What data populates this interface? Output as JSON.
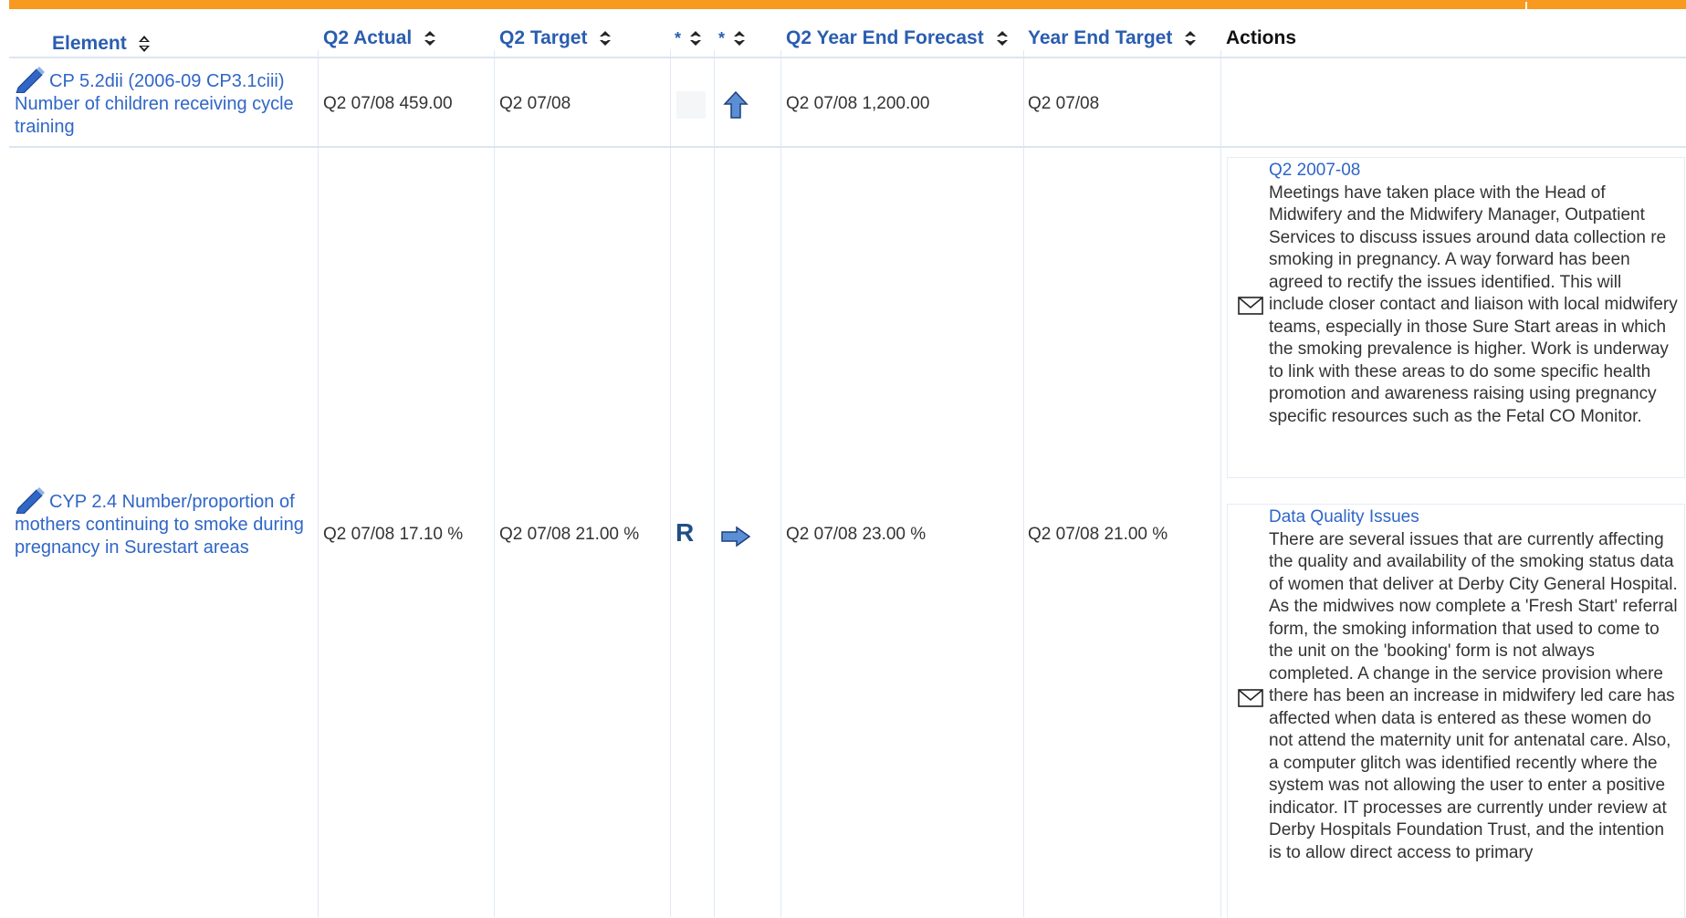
{
  "columns": {
    "element": "Element",
    "q2_actual": "Q2 Actual",
    "q2_target": "Q2 Target",
    "star1": "*",
    "star2": "*",
    "q2_forecast": "Q2 Year End Forecast",
    "ye_target": "Year End Target",
    "actions": "Actions"
  },
  "rows": [
    {
      "element": "CP 5.2dii (2006-09 CP3.1ciii) Number of children receiving cycle training",
      "q2_actual": "Q2 07/08  459.00",
      "q2_target": "Q2 07/08",
      "status": "",
      "trend_icon": "arrow-up-icon",
      "q2_forecast": "Q2 07/08  1,200.00",
      "ye_target": "Q2 07/08"
    },
    {
      "element": "CYP 2.4 Number/proportion of mothers continuing to smoke during pregnancy in Surestart areas",
      "q2_actual": "Q2 07/08 17.10 %",
      "q2_target": "Q2 07/08 21.00 %",
      "status": "R",
      "trend_icon": "arrow-right-icon",
      "q2_forecast": "Q2 07/08 23.00 %",
      "ye_target": "Q2 07/08 21.00 %",
      "notes": [
        {
          "title": "Q2 2007-08",
          "text": "Meetings have taken place with the Head of Midwifery and the Midwifery Manager, Outpatient Services to discuss issues around data collection re smoking in pregnancy. A way forward has been agreed to rectify the issues identified. This will include closer contact and liaison with local midwifery teams, especially in those Sure Start areas in which the smoking prevalence is higher. Work is underway to link with these areas to do some specific health promotion and awareness raising using pregnancy specific resources such as the Fetal CO Monitor."
        },
        {
          "title": "Data Quality Issues",
          "text": "There are several issues that are currently affecting the quality and availability of the smoking status data of women that deliver at Derby City General Hospital. As the midwives now complete a 'Fresh Start' referral form, the smoking information that used to come to the unit on the 'booking' form is not always completed. A change in the service provision where there has been an increase in midwifery led care has affected when data is entered as these women do not attend the maternity unit for antenatal care. Also, a computer glitch was identified recently where the system was not allowing the user to enter a positive indicator. IT processes are currently under review at Derby Hospitals Foundation Trust, and the intention is to allow direct access to primary"
        }
      ]
    }
  ],
  "colors": {
    "accent_bar": "#f79a1f",
    "link": "#2f66c7",
    "header_link": "#2a5db0"
  }
}
